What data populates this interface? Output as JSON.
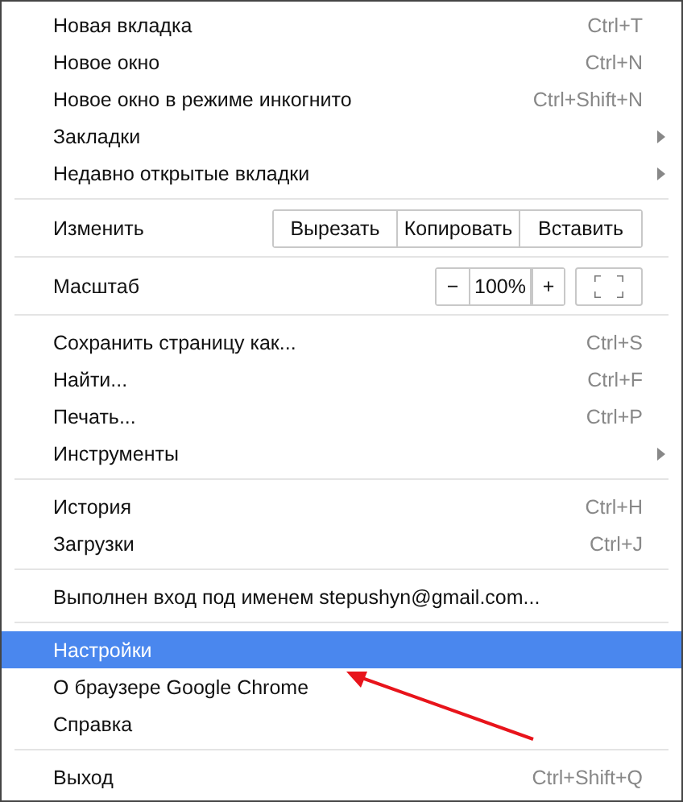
{
  "menu": {
    "sections": [
      {
        "items": [
          {
            "kind": "item",
            "label": "Новая вкладка",
            "shortcut": "Ctrl+T",
            "selected": false
          },
          {
            "kind": "item",
            "label": "Новое окно",
            "shortcut": "Ctrl+N",
            "selected": false
          },
          {
            "kind": "item",
            "label": "Новое окно в режиме инкогнито",
            "shortcut": "Ctrl+Shift+N",
            "selected": false
          },
          {
            "kind": "item",
            "label": "Закладки",
            "submenu": true,
            "selected": false
          },
          {
            "kind": "item",
            "label": "Недавно открытые вкладки",
            "submenu": true,
            "selected": false
          }
        ]
      },
      {
        "items": [
          {
            "kind": "edit",
            "label": "Изменить",
            "buttons": [
              "Вырезать",
              "Копировать",
              "Вставить"
            ]
          }
        ]
      },
      {
        "items": [
          {
            "kind": "zoom",
            "label": "Масштаб",
            "minus": "−",
            "value": "100%",
            "plus": "+"
          }
        ]
      },
      {
        "items": [
          {
            "kind": "item",
            "label": "Сохранить страницу как...",
            "shortcut": "Ctrl+S",
            "selected": false
          },
          {
            "kind": "item",
            "label": "Найти...",
            "shortcut": "Ctrl+F",
            "selected": false
          },
          {
            "kind": "item",
            "label": "Печать...",
            "shortcut": "Ctrl+P",
            "selected": false
          },
          {
            "kind": "item",
            "label": "Инструменты",
            "submenu": true,
            "selected": false
          }
        ]
      },
      {
        "items": [
          {
            "kind": "item",
            "label": "История",
            "shortcut": "Ctrl+H",
            "selected": false
          },
          {
            "kind": "item",
            "label": "Загрузки",
            "shortcut": "Ctrl+J",
            "selected": false
          }
        ]
      },
      {
        "items": [
          {
            "kind": "item",
            "label": "Выполнен вход под именем stepushyn@gmail.com...",
            "selected": false
          }
        ]
      },
      {
        "items": [
          {
            "kind": "item",
            "label": "Настройки",
            "selected": true
          },
          {
            "kind": "item",
            "label": "О браузере Google Chrome",
            "selected": false
          },
          {
            "kind": "item",
            "label": "Справка",
            "selected": false
          }
        ]
      },
      {
        "items": [
          {
            "kind": "item",
            "label": "Выход",
            "shortcut": "Ctrl+Shift+Q",
            "selected": false
          }
        ]
      }
    ]
  }
}
